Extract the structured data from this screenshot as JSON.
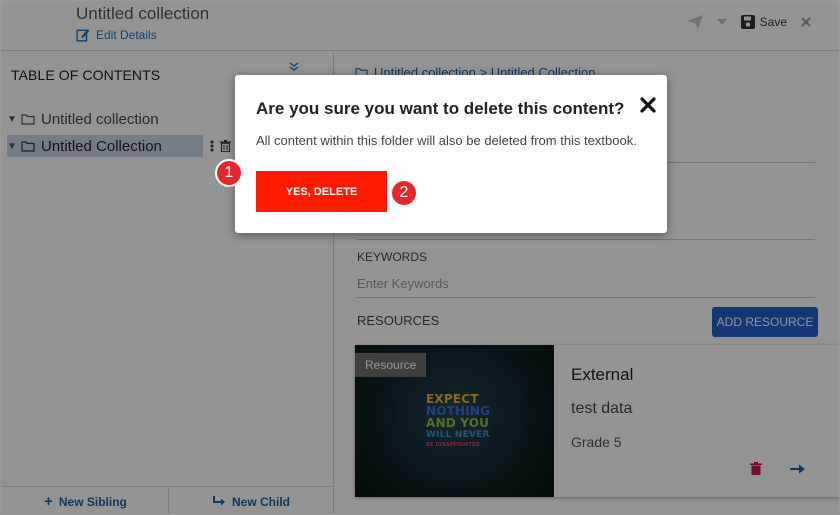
{
  "header": {
    "title": "Untitled collection",
    "edit_label": "Edit Details",
    "save_label": "Save"
  },
  "toc": {
    "title": "TABLE OF CONTENTS",
    "items": [
      {
        "label": "Untitled collection"
      },
      {
        "label": "Untitled Collection"
      }
    ],
    "new_sibling_label": "New Sibling",
    "new_child_label": "New Child"
  },
  "right": {
    "breadcrumb": "Untitled collection > Untitled Collection",
    "keywords_label": "KEYWORDS",
    "keywords_placeholder": "Enter Keywords",
    "resources_label": "RESOURCES",
    "add_resource_label": "ADD RESOURCE",
    "resource_card": {
      "badge": "Resource",
      "title": "External",
      "description": "test data",
      "grade": "Grade 5",
      "thumbnail_lines": [
        "EXPECT",
        "NOTHING",
        "AND YOU",
        "WILL NEVER",
        "BE DISAPPOINTED"
      ]
    }
  },
  "modal": {
    "title": "Are you sure you want to delete this content?",
    "message": "All content within this folder will also be deleted from this textbook.",
    "confirm_label": "YES, DELETE"
  },
  "annotations": {
    "step1": "1",
    "step2": "2"
  },
  "colors": {
    "accent_blue": "#1f5fc9",
    "delete_red": "#ff1a00",
    "badge_red": "#e8262c",
    "selected_row": "#c9d6e6"
  }
}
